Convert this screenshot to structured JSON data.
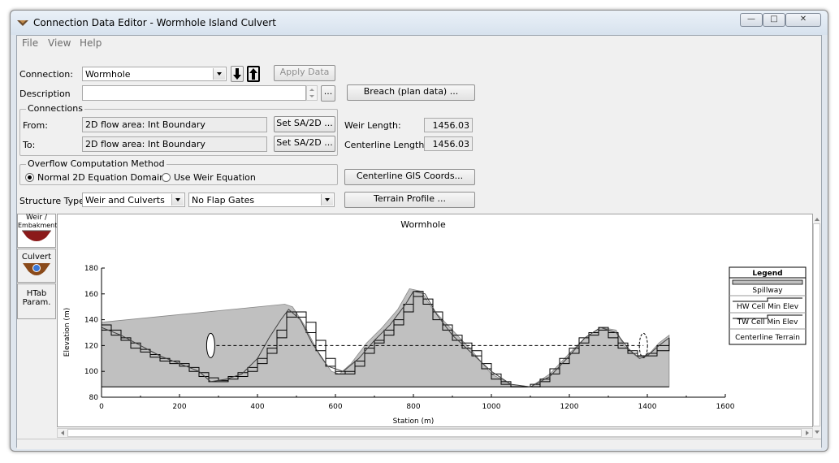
{
  "window": {
    "title": "Connection Data Editor - Wormhole Island Culvert",
    "minimize_glyph": "—",
    "maximize_glyph": "□",
    "close_glyph": "✕"
  },
  "menu": {
    "file": "File",
    "view": "View",
    "help": "Help"
  },
  "form": {
    "connection_label": "Connection:",
    "connection_value": "Wormhole",
    "apply_label": "Apply Data",
    "description_label": "Description",
    "description_value": "",
    "ellipsis_label": "...",
    "breach_label": "Breach (plan data) ..."
  },
  "connections": {
    "group_title": "Connections",
    "from_label": "From:",
    "from_value": "2D flow area: Int Boundary",
    "to_label": "To:",
    "to_value": "2D flow area: Int Boundary",
    "set_label": "Set SA/2D ...",
    "weir_length_label": "Weir Length:",
    "weir_length_value": "1456.03",
    "centerline_length_label": "Centerline Length:",
    "centerline_length_value": "1456.03"
  },
  "overflow": {
    "group_title": "Overflow Computation Method",
    "option_normal": "Normal 2D Equation Domain",
    "option_weir": "Use Weir Equation",
    "selected": "normal"
  },
  "buttons": {
    "centerline_gis": "Centerline GIS Coords...",
    "terrain_profile": "Terrain Profile ..."
  },
  "structure": {
    "label": "Structure Type:",
    "type_value": "Weir and Culverts",
    "gates_value": "No Flap Gates"
  },
  "side_tabs": {
    "weir_line1": "Weir /",
    "weir_line2": "Embakment",
    "culvert": "Culvert",
    "htab_line1": "HTab",
    "htab_line2": "Param."
  },
  "colors": {
    "fill": "#c0c0c0",
    "terrain": "#404040",
    "steps": "#000000",
    "weir_line": "#000000"
  },
  "chart_data": {
    "type": "area",
    "title": "Wormhole",
    "xlabel": "Station (m)",
    "ylabel": "Elevation (m)",
    "xlim": [
      0,
      1600
    ],
    "ylim": [
      80,
      180
    ],
    "xticks": [
      0,
      200,
      400,
      600,
      800,
      1000,
      1200,
      1400,
      1600
    ],
    "yticks": [
      80,
      100,
      120,
      140,
      160,
      180
    ],
    "legend_title": "Legend",
    "legend_position": "right",
    "legend": [
      "Spillway",
      "HW Cell Min Elev",
      "TW Cell Min Elev",
      "Centerline Terrain"
    ],
    "spillway": {
      "x": [
        0,
        470,
        490,
        520,
        560,
        590,
        610,
        640,
        680,
        720,
        760,
        790,
        820,
        850,
        900,
        950,
        1000,
        1050,
        1100,
        1150,
        1200,
        1240,
        1280,
        1320,
        1340,
        1370,
        1400,
        1430,
        1456
      ],
      "y": [
        138,
        152,
        150,
        136,
        112,
        100,
        98,
        106,
        122,
        134,
        148,
        164,
        162,
        148,
        132,
        116,
        98,
        90,
        88,
        98,
        114,
        126,
        134,
        132,
        120,
        112,
        112,
        122,
        128
      ]
    },
    "terrain": {
      "x": [
        0,
        50,
        100,
        150,
        200,
        250,
        280,
        320,
        360,
        400,
        430,
        460,
        480,
        510,
        540,
        580,
        620,
        660,
        700,
        740,
        780,
        800,
        830,
        860,
        900,
        950,
        1000,
        1050,
        1100,
        1150,
        1200,
        1240,
        1280,
        1320,
        1350,
        1380,
        1400,
        1430,
        1456
      ],
      "y": [
        134,
        128,
        120,
        112,
        106,
        100,
        92,
        94,
        98,
        110,
        126,
        140,
        148,
        140,
        122,
        104,
        100,
        110,
        124,
        136,
        152,
        162,
        160,
        144,
        128,
        114,
        100,
        90,
        88,
        96,
        112,
        126,
        134,
        130,
        118,
        110,
        112,
        120,
        126
      ]
    },
    "hw_cell": {
      "x": [
        0,
        25,
        50,
        75,
        100,
        125,
        150,
        175,
        200,
        225,
        250,
        275,
        300,
        325,
        350,
        375,
        400,
        425,
        450,
        475,
        500,
        525,
        550,
        575,
        600,
        625,
        650,
        675,
        700,
        725,
        750,
        775,
        800,
        825,
        850,
        875,
        900,
        925,
        950,
        975,
        1000,
        1025,
        1050,
        1075,
        1100,
        1125,
        1150,
        1175,
        1200,
        1225,
        1250,
        1275,
        1300,
        1325,
        1350,
        1375,
        1400,
        1425,
        1456
      ],
      "y": [
        132,
        128,
        124,
        118,
        115,
        111,
        108,
        106,
        104,
        100,
        96,
        92,
        92,
        94,
        96,
        100,
        106,
        114,
        126,
        142,
        146,
        138,
        124,
        110,
        100,
        98,
        104,
        114,
        122,
        128,
        136,
        146,
        158,
        156,
        146,
        136,
        128,
        122,
        116,
        106,
        98,
        92,
        88,
        88,
        88,
        92,
        98,
        106,
        114,
        122,
        128,
        132,
        130,
        122,
        116,
        112,
        112,
        116,
        124
      ]
    },
    "tw_cell": {
      "x": [
        0,
        25,
        50,
        75,
        100,
        125,
        150,
        175,
        200,
        225,
        250,
        275,
        300,
        325,
        350,
        375,
        400,
        425,
        450,
        475,
        500,
        525,
        550,
        575,
        600,
        625,
        650,
        675,
        700,
        725,
        750,
        775,
        800,
        825,
        850,
        875,
        900,
        925,
        950,
        975,
        1000,
        1025,
        1050,
        1075,
        1100,
        1125,
        1150,
        1175,
        1200,
        1225,
        1250,
        1275,
        1300,
        1325,
        1350,
        1375,
        1400,
        1425,
        1456
      ],
      "y": [
        136,
        132,
        126,
        122,
        117,
        113,
        110,
        108,
        106,
        103,
        99,
        95,
        93,
        96,
        99,
        103,
        110,
        118,
        132,
        146,
        142,
        130,
        116,
        104,
        98,
        100,
        108,
        118,
        124,
        132,
        140,
        152,
        162,
        152,
        140,
        132,
        124,
        118,
        112,
        102,
        94,
        90,
        88,
        88,
        90,
        94,
        102,
        110,
        118,
        126,
        130,
        134,
        126,
        118,
        114,
        112,
        114,
        120,
        126
      ]
    },
    "culvert_line": {
      "x": [
        280,
        1390
      ],
      "y": [
        120,
        120
      ]
    },
    "culverts": [
      {
        "x": 280,
        "y": 120
      },
      {
        "x": 1390,
        "y": 120
      }
    ]
  }
}
